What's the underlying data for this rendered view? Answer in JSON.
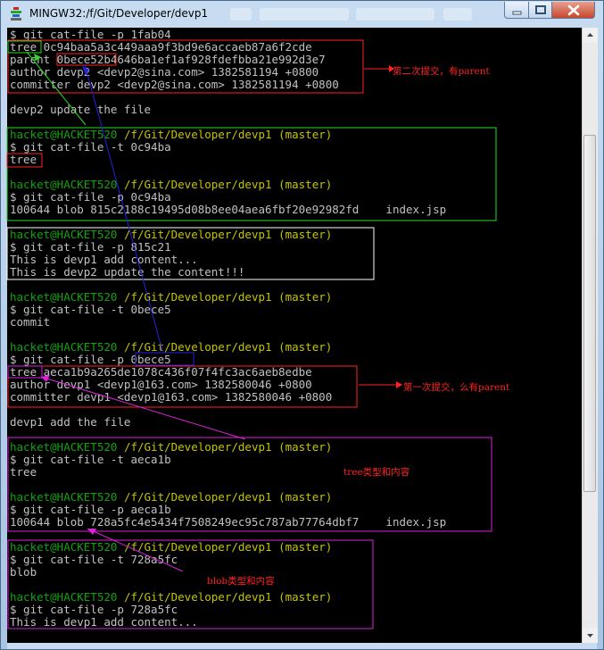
{
  "window": {
    "title": "MINGW32:/f/Git/Developer/devp1"
  },
  "terminal": {
    "lines": [
      {
        "t": "$ git cat-file -p 1fab04"
      },
      {
        "t": "tree 0c94baa5a3c449aaa9f3bd9e6accaeb87a6f2cde"
      },
      {
        "t": "parent 0bece52b4646ba1ef1af928fdefbba21e992d3e7"
      },
      {
        "t": "author devp2 <devp2@sina.com> 1382581194 +0800"
      },
      {
        "t": "committer devp2 <devp2@sina.com> 1382581194 +0800"
      },
      {
        "t": ""
      },
      {
        "t": "devp2 update the file"
      },
      {
        "t": ""
      },
      {
        "p": true,
        "user": "hacket@HACKET520",
        "path": "/f/Git/Developer/devp1",
        "branch": "(master)"
      },
      {
        "t": "$ git cat-file -t 0c94ba"
      },
      {
        "t": "tree"
      },
      {
        "t": ""
      },
      {
        "p": true,
        "user": "hacket@HACKET520",
        "path": "/f/Git/Developer/devp1",
        "branch": "(master)"
      },
      {
        "t": "$ git cat-file -p 0c94ba"
      },
      {
        "t": "100644 blob 815c2188c19495d08b8ee04aea6fbf20e92982fd    index.jsp"
      },
      {
        "t": ""
      },
      {
        "p": true,
        "user": "hacket@HACKET520",
        "path": "/f/Git/Developer/devp1",
        "branch": "(master)"
      },
      {
        "t": "$ git cat-file -p 815c21"
      },
      {
        "t": "This is devp1 add content..."
      },
      {
        "t": "This is devp2 update the content!!!"
      },
      {
        "t": ""
      },
      {
        "p": true,
        "user": "hacket@HACKET520",
        "path": "/f/Git/Developer/devp1",
        "branch": "(master)"
      },
      {
        "t": "$ git cat-file -t 0bece5"
      },
      {
        "t": "commit"
      },
      {
        "t": ""
      },
      {
        "p": true,
        "user": "hacket@HACKET520",
        "path": "/f/Git/Developer/devp1",
        "branch": "(master)"
      },
      {
        "t": "$ git cat-file -p 0bece5"
      },
      {
        "t": "tree aeca1b9a265de1078c436f07f4fc3ac6aeb8edbe"
      },
      {
        "t": "author devp1 <devp1@163.com> 1382580046 +0800"
      },
      {
        "t": "committer devp1 <devp1@163.com> 1382580046 +0800"
      },
      {
        "t": ""
      },
      {
        "t": "devp1 add the file"
      },
      {
        "t": ""
      },
      {
        "p": true,
        "user": "hacket@HACKET520",
        "path": "/f/Git/Developer/devp1",
        "branch": "(master)"
      },
      {
        "t": "$ git cat-file -t aeca1b"
      },
      {
        "t": "tree"
      },
      {
        "t": ""
      },
      {
        "p": true,
        "user": "hacket@HACKET520",
        "path": "/f/Git/Developer/devp1",
        "branch": "(master)"
      },
      {
        "t": "$ git cat-file -p aeca1b"
      },
      {
        "t": "100644 blob 728a5fc4e5434f7508249ec95c787ab77764dbf7    index.jsp"
      },
      {
        "t": ""
      },
      {
        "p": true,
        "user": "hacket@HACKET520",
        "path": "/f/Git/Developer/devp1",
        "branch": "(master)"
      },
      {
        "t": "$ git cat-file -t 728a5fc"
      },
      {
        "t": "blob"
      },
      {
        "t": ""
      },
      {
        "p": true,
        "user": "hacket@HACKET520",
        "path": "/f/Git/Developer/devp1",
        "branch": "(master)"
      },
      {
        "t": "$ git cat-file -p 728a5fc"
      },
      {
        "t": "This is devp1 add content..."
      }
    ]
  },
  "annotations": {
    "second_commit": "第二次提交，有parent",
    "first_commit": "第一次提交，么有parent",
    "tree_note": "tree类型和内容",
    "blob_note": "blob类型和内容"
  },
  "colors": {
    "terminal_bg": "#000000",
    "terminal_text": "#c0c0c0",
    "prompt_user": "#13a10e",
    "prompt_path": "#c4c400",
    "annot_red": "#ff2222",
    "annot_green": "#22dd22",
    "annot_blue": "#2222dd",
    "annot_magenta": "#dd22dd",
    "annot_white": "#ffffff"
  },
  "icons": {
    "app": "git-bash-icon",
    "minimize": "minimize-icon",
    "maximize": "maximize-icon",
    "close": "close-icon"
  }
}
